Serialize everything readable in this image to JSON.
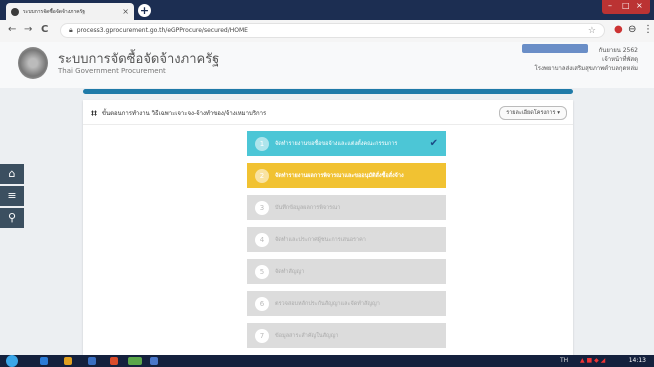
{
  "browser": {
    "tab_title": "ระบบการจัดซื้อจัดจ้างภาครัฐ",
    "tab_close": "×",
    "new_tab": "+",
    "nav_back": "←",
    "nav_forward": "→",
    "nav_reload": "C",
    "url": "process3.gprocurement.go.th/eGPProcure/secured/HOME",
    "star": "☆",
    "ext1": "●",
    "ext2": "⊖",
    "menu": "⋮"
  },
  "site": {
    "title": "ระบบการจัดซื้อจัดจ้างภาครัฐ",
    "subtitle": "Thai Government Procurement",
    "user_date": "กันยายน 2562",
    "user_role": "เจ้าหน้าที่พัสดุ",
    "user_org": "โรงพยาบาลส่งเสริมสุขภาพตำบลกุดหล่ม"
  },
  "sidemenu": {
    "home_glyph": "⌂",
    "menu_glyph": "≡",
    "search_glyph": "⚲"
  },
  "main": {
    "header_icon": "‡‡",
    "header_text": "ขั้นตอนการทำงาน วิธีเฉพาะเจาะจง-จ้างทำของ/จ้างเหมาบริการ",
    "dropdown_label": "รายละเอียดโครงการ ▾",
    "steps": [
      {
        "num": "1",
        "label": "จัดทำรายงานขอซื้อขอจ้างและแต่งตั้งคณะกรรมการ",
        "status": "done",
        "check": "✔"
      },
      {
        "num": "2",
        "label": "จัดทำรายงานผลการพิจารณาและขออนุมัติสั่งซื้อสั่งจ้าง",
        "status": "active",
        "check": ""
      },
      {
        "num": "3",
        "label": "บันทึกข้อมูลผลการพิจารณา",
        "status": "pending",
        "check": ""
      },
      {
        "num": "4",
        "label": "จัดทำและประกาศผู้ชนะการเสนอราคา",
        "status": "pending",
        "check": ""
      },
      {
        "num": "5",
        "label": "จัดทำสัญญา",
        "status": "pending",
        "check": ""
      },
      {
        "num": "6",
        "label": "ตรวจสอบหลักประกันสัญญาและจัดทำสัญญา",
        "status": "pending",
        "check": ""
      },
      {
        "num": "7",
        "label": "ข้อมูลสาระสำคัญในสัญญา",
        "status": "pending",
        "check": ""
      }
    ]
  },
  "taskbar": {
    "lang": "TH",
    "clock": "14:13"
  },
  "colors": {
    "done": "#4cc6d6",
    "active": "#f1c232",
    "pending": "#dcdcdc",
    "accent": "#1f7aa8"
  }
}
